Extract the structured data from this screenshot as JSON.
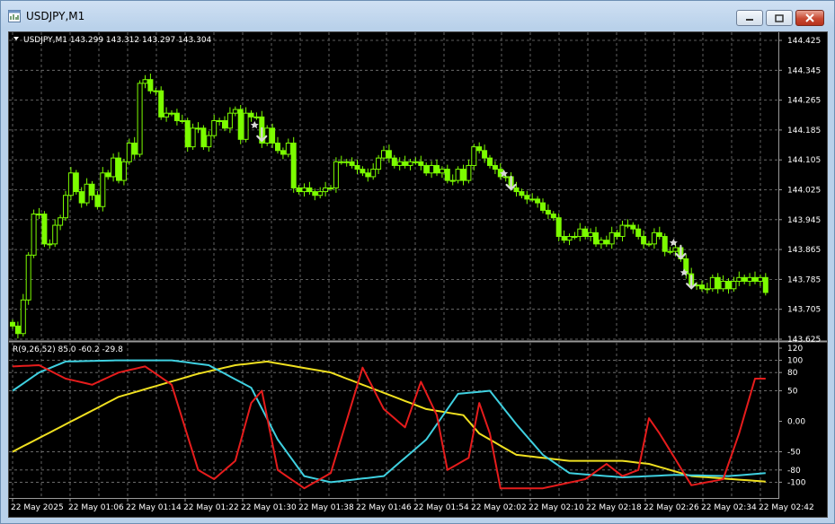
{
  "window": {
    "title": "USDJPY,M1"
  },
  "main": {
    "info": "USDJPY,M1  143.299 143.312 143.297 143.304",
    "price_ticks": [
      "144.425",
      "144.345",
      "144.265",
      "144.185",
      "144.105",
      "144.025",
      "143.945",
      "143.865",
      "143.785",
      "143.705",
      "143.625"
    ]
  },
  "indicator": {
    "info": "R(9,26,52) 85.0 -60.2 -29.8",
    "ticks": [
      "120",
      "100",
      "80",
      "50",
      "0.00",
      "-50",
      "-80",
      "-100"
    ]
  },
  "time_axis": {
    "labels": [
      "22 May 2025",
      "22 May 01:06",
      "22 May 01:14",
      "22 May 01:22",
      "22 May 01:30",
      "22 May 01:38",
      "22 May 01:46",
      "22 May 01:54",
      "22 May 02:02",
      "22 May 02:10",
      "22 May 02:18",
      "22 May 02:26",
      "22 May 02:34",
      "22 May 02:42"
    ]
  },
  "colors": {
    "background": "#000000",
    "grid": "#7a7a7a",
    "candle": "#7cfc00",
    "text": "#ffffff",
    "red_line": "#e61c1c",
    "cyan_line": "#3fd0e0",
    "yellow_line": "#f0e020",
    "arrow": "#d8d8d8"
  },
  "icons": {
    "app": "chart-window-icon",
    "minimize": "minimize-icon",
    "maximize": "maximize-icon",
    "close": "close-icon",
    "info_marker": "triangle-down-icon",
    "signal": "down-arrow-icon"
  },
  "chart_data": {
    "type": "candlestick",
    "symbol": "USDJPY",
    "timeframe": "M1",
    "ylim": [
      143.625,
      144.425
    ],
    "close": [
      143.66,
      143.64,
      143.73,
      143.85,
      143.96,
      143.96,
      143.88,
      143.88,
      143.93,
      143.95,
      144.01,
      144.07,
      144.02,
      143.99,
      144.04,
      144.01,
      143.98,
      144.07,
      144.06,
      144.11,
      144.05,
      144.1,
      144.15,
      144.12,
      144.31,
      144.32,
      144.29,
      144.29,
      144.22,
      144.23,
      144.23,
      144.21,
      144.21,
      144.14,
      144.19,
      144.19,
      144.14,
      144.17,
      144.21,
      144.21,
      144.19,
      144.23,
      144.24,
      144.16,
      144.23,
      144.22,
      144.22,
      144.15,
      144.19,
      144.15,
      144.13,
      144.12,
      144.15,
      144.03,
      144.02,
      144.03,
      144.02,
      144.01,
      144.02,
      144.03,
      144.03,
      144.1,
      144.1,
      144.1,
      144.09,
      144.08,
      144.07,
      144.06,
      144.08,
      144.11,
      144.13,
      144.11,
      144.09,
      144.1,
      144.09,
      144.1,
      144.1,
      144.09,
      144.07,
      144.09,
      144.07,
      144.08,
      144.05,
      144.05,
      144.08,
      144.05,
      144.09,
      144.14,
      144.13,
      144.11,
      144.09,
      144.08,
      144.06,
      144.06,
      144.03,
      144.02,
      144.01,
      144.0,
      144.0,
      143.99,
      143.97,
      143.96,
      143.95,
      143.9,
      143.89,
      143.9,
      143.9,
      143.92,
      143.9,
      143.91,
      143.88,
      143.89,
      143.88,
      143.91,
      143.9,
      143.93,
      143.93,
      143.92,
      143.9,
      143.88,
      143.88,
      143.91,
      143.9,
      143.86,
      143.86,
      143.87,
      143.84,
      143.8,
      143.77,
      143.77,
      143.76,
      143.76,
      143.79,
      143.76,
      143.78,
      143.76,
      143.78,
      143.79,
      143.78,
      143.79,
      143.78,
      143.79,
      143.75
    ]
  }
}
